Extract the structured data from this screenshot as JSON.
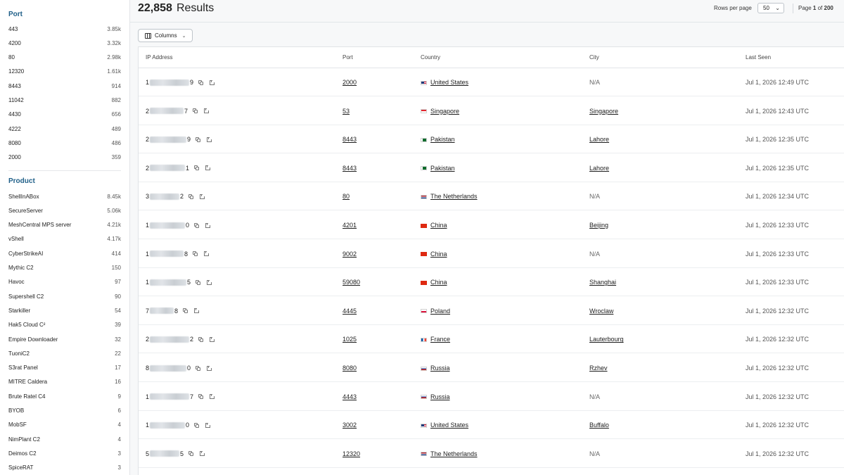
{
  "sidebar": {
    "port": {
      "title": "Port",
      "items": [
        {
          "label": "443",
          "count": "3.85k"
        },
        {
          "label": "4200",
          "count": "3.32k"
        },
        {
          "label": "80",
          "count": "2.98k"
        },
        {
          "label": "12320",
          "count": "1.61k"
        },
        {
          "label": "8443",
          "count": "914"
        },
        {
          "label": "11042",
          "count": "882"
        },
        {
          "label": "4430",
          "count": "656"
        },
        {
          "label": "4222",
          "count": "489"
        },
        {
          "label": "8080",
          "count": "486"
        },
        {
          "label": "2000",
          "count": "359"
        }
      ]
    },
    "product": {
      "title": "Product",
      "items": [
        {
          "label": "ShellInABox",
          "count": "8.45k"
        },
        {
          "label": "SecureServer",
          "count": "5.06k"
        },
        {
          "label": "MeshCentral MPS server",
          "count": "4.21k"
        },
        {
          "label": "vShell",
          "count": "4.17k"
        },
        {
          "label": "CyberStrikeAI",
          "count": "414"
        },
        {
          "label": "Mythic C2",
          "count": "150"
        },
        {
          "label": "Havoc",
          "count": "97"
        },
        {
          "label": "Supershell C2",
          "count": "90"
        },
        {
          "label": "Starkiller",
          "count": "54"
        },
        {
          "label": "Hak5 Cloud C²",
          "count": "39"
        },
        {
          "label": "Empire Downloader",
          "count": "32"
        },
        {
          "label": "TuoniC2",
          "count": "22"
        },
        {
          "label": "S3rat Panel",
          "count": "17"
        },
        {
          "label": "MITRE Caldera",
          "count": "16"
        },
        {
          "label": "Brute Ratel C4",
          "count": "9"
        },
        {
          "label": "BYOB",
          "count": "6"
        },
        {
          "label": "MobSF",
          "count": "4"
        },
        {
          "label": "NimPlant C2",
          "count": "4"
        },
        {
          "label": "Deimos C2",
          "count": "3"
        },
        {
          "label": "SpiceRAT",
          "count": "3"
        }
      ]
    }
  },
  "header": {
    "results_count": "22,858",
    "results_label": "Results",
    "rows_per_page_label": "Rows per page",
    "rows_per_page_value": "50",
    "page_label": "Page",
    "page_current": "1",
    "page_of": "of",
    "page_total": "200",
    "columns_button": "Columns"
  },
  "table": {
    "columns": [
      "IP Address",
      "Port",
      "Country",
      "City",
      "Last Seen"
    ],
    "rows": [
      {
        "ip_first": "1",
        "ip_last": "9",
        "port": "2000",
        "flag": "us",
        "country": "United States",
        "city": "N/A",
        "last_seen": "Jul 1, 2026 12:49 UTC"
      },
      {
        "ip_first": "2",
        "ip_last": "7",
        "port": "53",
        "flag": "sg",
        "country": "Singapore",
        "city": "Singapore",
        "last_seen": "Jul 1, 2026 12:43 UTC"
      },
      {
        "ip_first": "2",
        "ip_last": "9",
        "port": "8443",
        "flag": "pk",
        "country": "Pakistan",
        "city": "Lahore",
        "last_seen": "Jul 1, 2026 12:35 UTC"
      },
      {
        "ip_first": "2",
        "ip_last": "1",
        "port": "8443",
        "flag": "pk",
        "country": "Pakistan",
        "city": "Lahore",
        "last_seen": "Jul 1, 2026 12:35 UTC"
      },
      {
        "ip_first": "3",
        "ip_last": "2",
        "port": "80",
        "flag": "nl",
        "country": "The Netherlands",
        "city": "N/A",
        "last_seen": "Jul 1, 2026 12:34 UTC"
      },
      {
        "ip_first": "1",
        "ip_last": "0",
        "port": "4201",
        "flag": "cn",
        "country": "China",
        "city": "Beijing",
        "last_seen": "Jul 1, 2026 12:33 UTC"
      },
      {
        "ip_first": "1",
        "ip_last": "8",
        "port": "9002",
        "flag": "cn",
        "country": "China",
        "city": "N/A",
        "last_seen": "Jul 1, 2026 12:33 UTC"
      },
      {
        "ip_first": "1",
        "ip_last": "5",
        "port": "59080",
        "flag": "cn",
        "country": "China",
        "city": "Shanghai",
        "last_seen": "Jul 1, 2026 12:33 UTC"
      },
      {
        "ip_first": "7",
        "ip_last": "8",
        "port": "4445",
        "flag": "pl",
        "country": "Poland",
        "city": "Wroclaw",
        "last_seen": "Jul 1, 2026 12:32 UTC"
      },
      {
        "ip_first": "2",
        "ip_last": "2",
        "port": "1025",
        "flag": "fr",
        "country": "France",
        "city": "Lauterbourg",
        "last_seen": "Jul 1, 2026 12:32 UTC"
      },
      {
        "ip_first": "8",
        "ip_last": "0",
        "port": "8080",
        "flag": "ru",
        "country": "Russia",
        "city": "Rzhev",
        "last_seen": "Jul 1, 2026 12:32 UTC"
      },
      {
        "ip_first": "1",
        "ip_last": "7",
        "port": "4443",
        "flag": "ru",
        "country": "Russia",
        "city": "N/A",
        "last_seen": "Jul 1, 2026 12:32 UTC"
      },
      {
        "ip_first": "1",
        "ip_last": "0",
        "port": "3002",
        "flag": "us",
        "country": "United States",
        "city": "Buffalo",
        "last_seen": "Jul 1, 2026 12:32 UTC"
      },
      {
        "ip_first": "5",
        "ip_last": "5",
        "port": "12320",
        "flag": "nl",
        "country": "The Netherlands",
        "city": "N/A",
        "last_seen": "Jul 1, 2026 12:32 UTC"
      }
    ]
  }
}
